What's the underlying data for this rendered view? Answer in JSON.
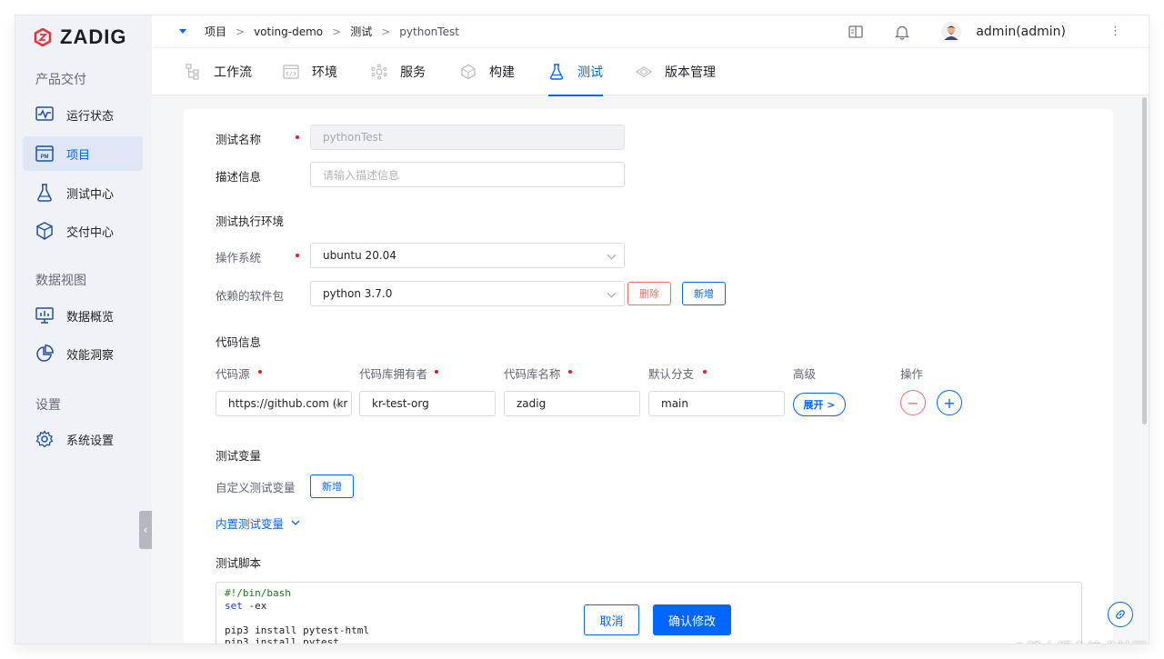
{
  "brand": {
    "name": "ZADIG",
    "accent": "#0066ff",
    "logo_color": "#e0373b"
  },
  "sidebar": {
    "sections": [
      {
        "title": "产品交付"
      },
      {
        "title": "数据视图"
      },
      {
        "title": "设置"
      }
    ],
    "items": [
      {
        "label": "运行状态",
        "icon": "pulse-monitor-icon"
      },
      {
        "label": "项目",
        "icon": "project-pm-icon",
        "active": true
      },
      {
        "label": "测试中心",
        "icon": "flask-icon"
      },
      {
        "label": "交付中心",
        "icon": "cube-package-icon"
      },
      {
        "label": "数据概览",
        "icon": "dashboard-chart-icon"
      },
      {
        "label": "效能洞察",
        "icon": "pie-chart-icon"
      },
      {
        "label": "系统设置",
        "icon": "gear-icon"
      }
    ],
    "collapse_glyph": "‹"
  },
  "header": {
    "breadcrumbs": [
      "项目",
      "voting-demo",
      "测试",
      "pythonTest"
    ],
    "separator": ">",
    "user": "admin(admin)"
  },
  "tabs": [
    {
      "label": "工作流",
      "icon": "workflow-icon"
    },
    {
      "label": "环境",
      "icon": "environment-icon"
    },
    {
      "label": "服务",
      "icon": "service-icon"
    },
    {
      "label": "构建",
      "icon": "build-icon"
    },
    {
      "label": "测试",
      "icon": "flask-icon",
      "active": true
    },
    {
      "label": "版本管理",
      "icon": "version-icon"
    }
  ],
  "form": {
    "test_name_label": "测试名称",
    "test_name_value": "pythonTest",
    "description_label": "描述信息",
    "description_placeholder": "请输入描述信息",
    "env_section_title": "测试执行环境",
    "os_label": "操作系统",
    "os_value": "ubuntu 20.04",
    "deps_label": "依赖的软件包",
    "deps_value": "python 3.7.0",
    "delete_label": "删除",
    "add_label": "新增",
    "code_section_title": "代码信息",
    "code_columns": [
      "代码源",
      "代码库拥有者",
      "代码库名称",
      "默认分支",
      "高级",
      "操作"
    ],
    "code_row": {
      "source": "https://github.com (kr",
      "owner": "kr-test-org",
      "repo": "zadig",
      "branch": "main",
      "expand_label": "展开 >"
    },
    "minus_glyph": "−",
    "plus_glyph": "+",
    "vars_section_title": "测试变量",
    "custom_vars_label": "自定义测试变量",
    "custom_vars_add": "新增",
    "builtin_vars_link": "内置测试变量",
    "script_section_title": "测试脚本",
    "script_lines": [
      {
        "text": "#!/bin/bash",
        "cls": "cm"
      },
      {
        "text": "set -ex",
        "cls": "kw-line"
      },
      {
        "text": "",
        "cls": ""
      },
      {
        "text": "pip3 install pytest-html",
        "cls": ""
      },
      {
        "text": "pip3 install pytest",
        "cls": ""
      }
    ]
  },
  "footer": {
    "cancel_label": "取消",
    "confirm_label": "确认修改"
  },
  "watermark": "@稀土掘金技术社区"
}
